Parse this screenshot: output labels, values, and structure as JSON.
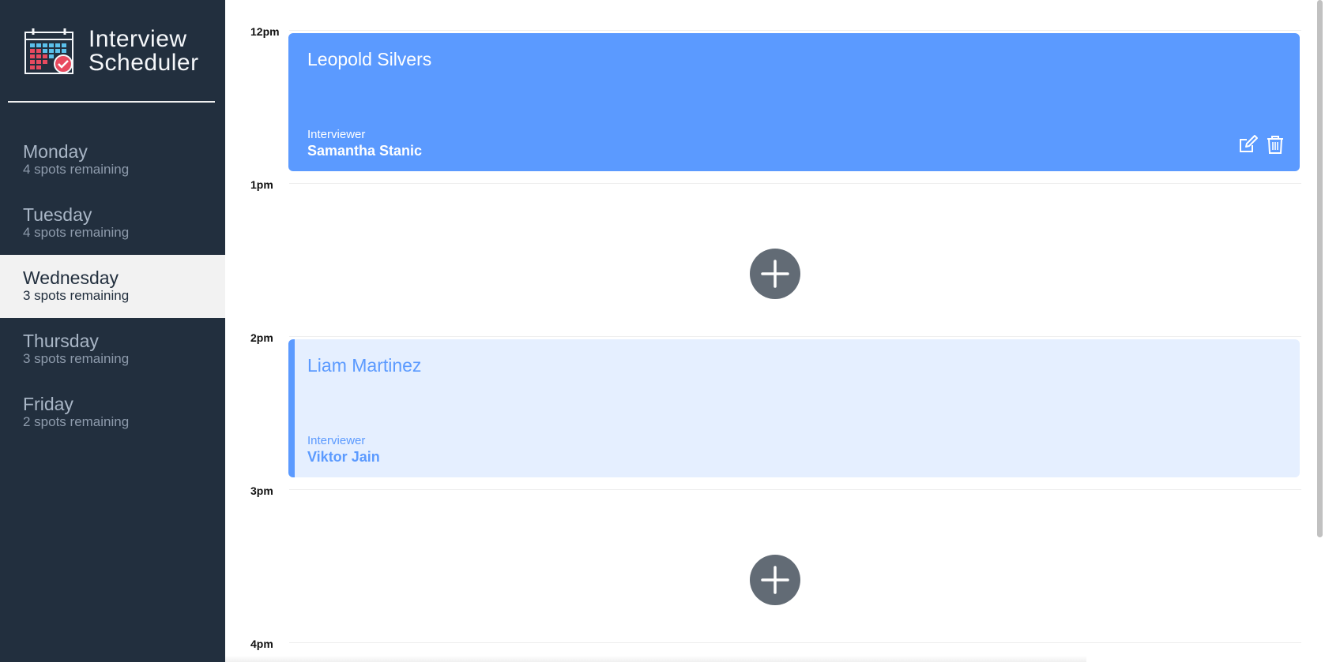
{
  "brand": {
    "line1": "Interview",
    "line2": "Scheduler",
    "icon": "calendar-check-icon"
  },
  "days": [
    {
      "name": "Monday",
      "spots": "4 spots remaining",
      "selected": false
    },
    {
      "name": "Tuesday",
      "spots": "4 spots remaining",
      "selected": false
    },
    {
      "name": "Wednesday",
      "spots": "3 spots remaining",
      "selected": true
    },
    {
      "name": "Thursday",
      "spots": "3 spots remaining",
      "selected": false
    },
    {
      "name": "Friday",
      "spots": "2 spots remaining",
      "selected": false
    }
  ],
  "slots": [
    {
      "time": "12pm",
      "appointment": {
        "student": "Leopold Silvers",
        "interviewer_label": "Interviewer",
        "interviewer": "Samantha Stanic",
        "style": "booked",
        "actions": [
          "edit-icon",
          "trash-icon"
        ]
      }
    },
    {
      "time": "1pm",
      "add_button": "add-icon"
    },
    {
      "time": "2pm",
      "appointment": {
        "student": "Liam Martinez",
        "interviewer_label": "Interviewer",
        "interviewer": "Viktor Jain",
        "style": "light"
      }
    },
    {
      "time": "3pm",
      "add_button": "add-icon"
    },
    {
      "time": "4pm"
    }
  ],
  "colors": {
    "sidebar": "#222f3e",
    "accent": "#5b9aff",
    "accent_light": "#e5efff",
    "add_button": "#626b75",
    "selected_day_bg": "#f2f2f2"
  }
}
